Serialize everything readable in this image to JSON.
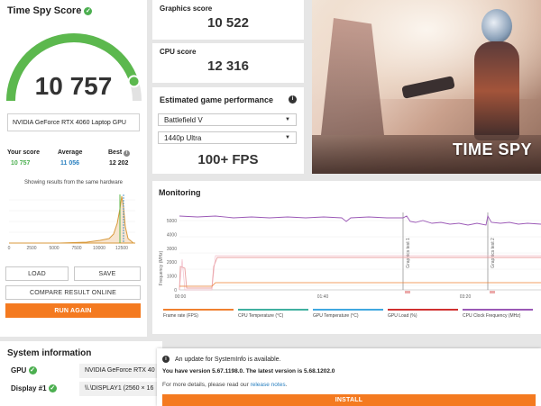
{
  "score_panel": {
    "title": "Time Spy Score",
    "score": "10 757",
    "gpu_name": "NVIDIA GeForce RTX 4060 Laptop GPU",
    "gauge_fill": 0.9,
    "your_score_label": "Your score",
    "your_score_value": "10 757",
    "average_label": "Average",
    "average_value": "11 056",
    "best_label": "Best",
    "best_value": "12 202",
    "hardware_note": "Showing results from the same hardware",
    "dist_ticks": [
      "0",
      "2500",
      "5000",
      "7500",
      "10000",
      "12500"
    ]
  },
  "actions": {
    "load": "LOAD",
    "save": "SAVE",
    "compare": "COMPARE RESULT ONLINE",
    "run_again": "RUN AGAIN"
  },
  "graphics": {
    "label": "Graphics score",
    "value": "10 522"
  },
  "cpu": {
    "label": "CPU score",
    "value": "12 316"
  },
  "game_perf": {
    "title": "Estimated game performance",
    "game": "Battlefield V",
    "preset": "1440p Ultra",
    "fps": "100+ FPS"
  },
  "banner": {
    "title": "TIME SPY"
  },
  "monitoring": {
    "title": "Monitoring",
    "y_label": "Frequency (MHz)",
    "y_ticks": [
      "5000",
      "4000",
      "3000",
      "2000",
      "1000",
      "0"
    ],
    "x_ticks": [
      "00:00",
      "01:40",
      "03:20"
    ],
    "markers": [
      "Graphics test 1",
      "Graphics test 2"
    ],
    "legend": [
      {
        "label": "Frame rate (FPS)",
        "color": "#f08030"
      },
      {
        "label": "CPU Temperature (°C)",
        "color": "#40b0a0"
      },
      {
        "label": "GPU Temperature (°C)",
        "color": "#40a8e0"
      },
      {
        "label": "GPU Load (%)",
        "color": "#d03030"
      },
      {
        "label": "CPU Clock Frequency (MHz)",
        "color": "#9b59b6"
      }
    ]
  },
  "system_info": {
    "title": "System information",
    "gpu_label": "GPU",
    "gpu_value": "NVIDIA GeForce RTX 40",
    "display_label": "Display #1",
    "display_value": "\\\\.\\DISPLAY1 (2560 × 16"
  },
  "update": {
    "title": "An update for SystemInfo is available.",
    "version_text": "You have version 5.67.1198.0. The latest version is 5.68.1202.0",
    "details_prefix": "For more details, please read our ",
    "details_link": "release notes",
    "details_suffix": ".",
    "install": "INSTALL"
  }
}
